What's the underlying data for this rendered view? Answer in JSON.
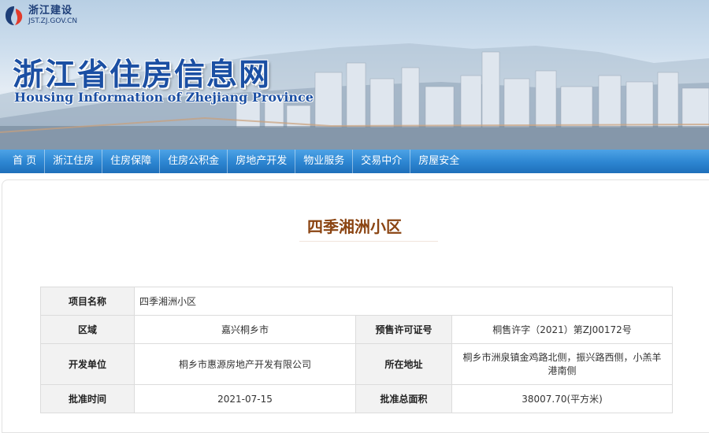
{
  "site": {
    "logo_name": "浙江建设",
    "logo_url": "JST.ZJ.GOV.CN",
    "title_cn": "浙江省住房信息网",
    "title_en": "Housing Information of Zhejiang Province"
  },
  "nav": {
    "items": [
      "首 页",
      "浙江住房",
      "住房保障",
      "住房公积金",
      "房地产开发",
      "物业服务",
      "交易中介",
      "房屋安全"
    ]
  },
  "page": {
    "title": "四季湘洲小区"
  },
  "project": {
    "name_label": "项目名称",
    "name_value": "四季湘洲小区",
    "region_label": "区域",
    "region_value": "嘉兴桐乡市",
    "permit_label": "预售许可证号",
    "permit_value": "桐售许字（2021）第ZJ00172号",
    "developer_label": "开发单位",
    "developer_value": "桐乡市惠源房地产开发有限公司",
    "address_label": "所在地址",
    "address_value": "桐乡市洲泉镇金鸡路北侧，振兴路西侧，小羔羊港南侧",
    "approval_date_label": "批准时间",
    "approval_date_value": "2021-07-15",
    "approved_area_label": "批准总面积",
    "approved_area_value": "38007.70(平方米)"
  },
  "colors": {
    "nav_blue": "#2c85d1",
    "title_brown": "#8b4513",
    "brand_blue": "#1b4fa3"
  }
}
